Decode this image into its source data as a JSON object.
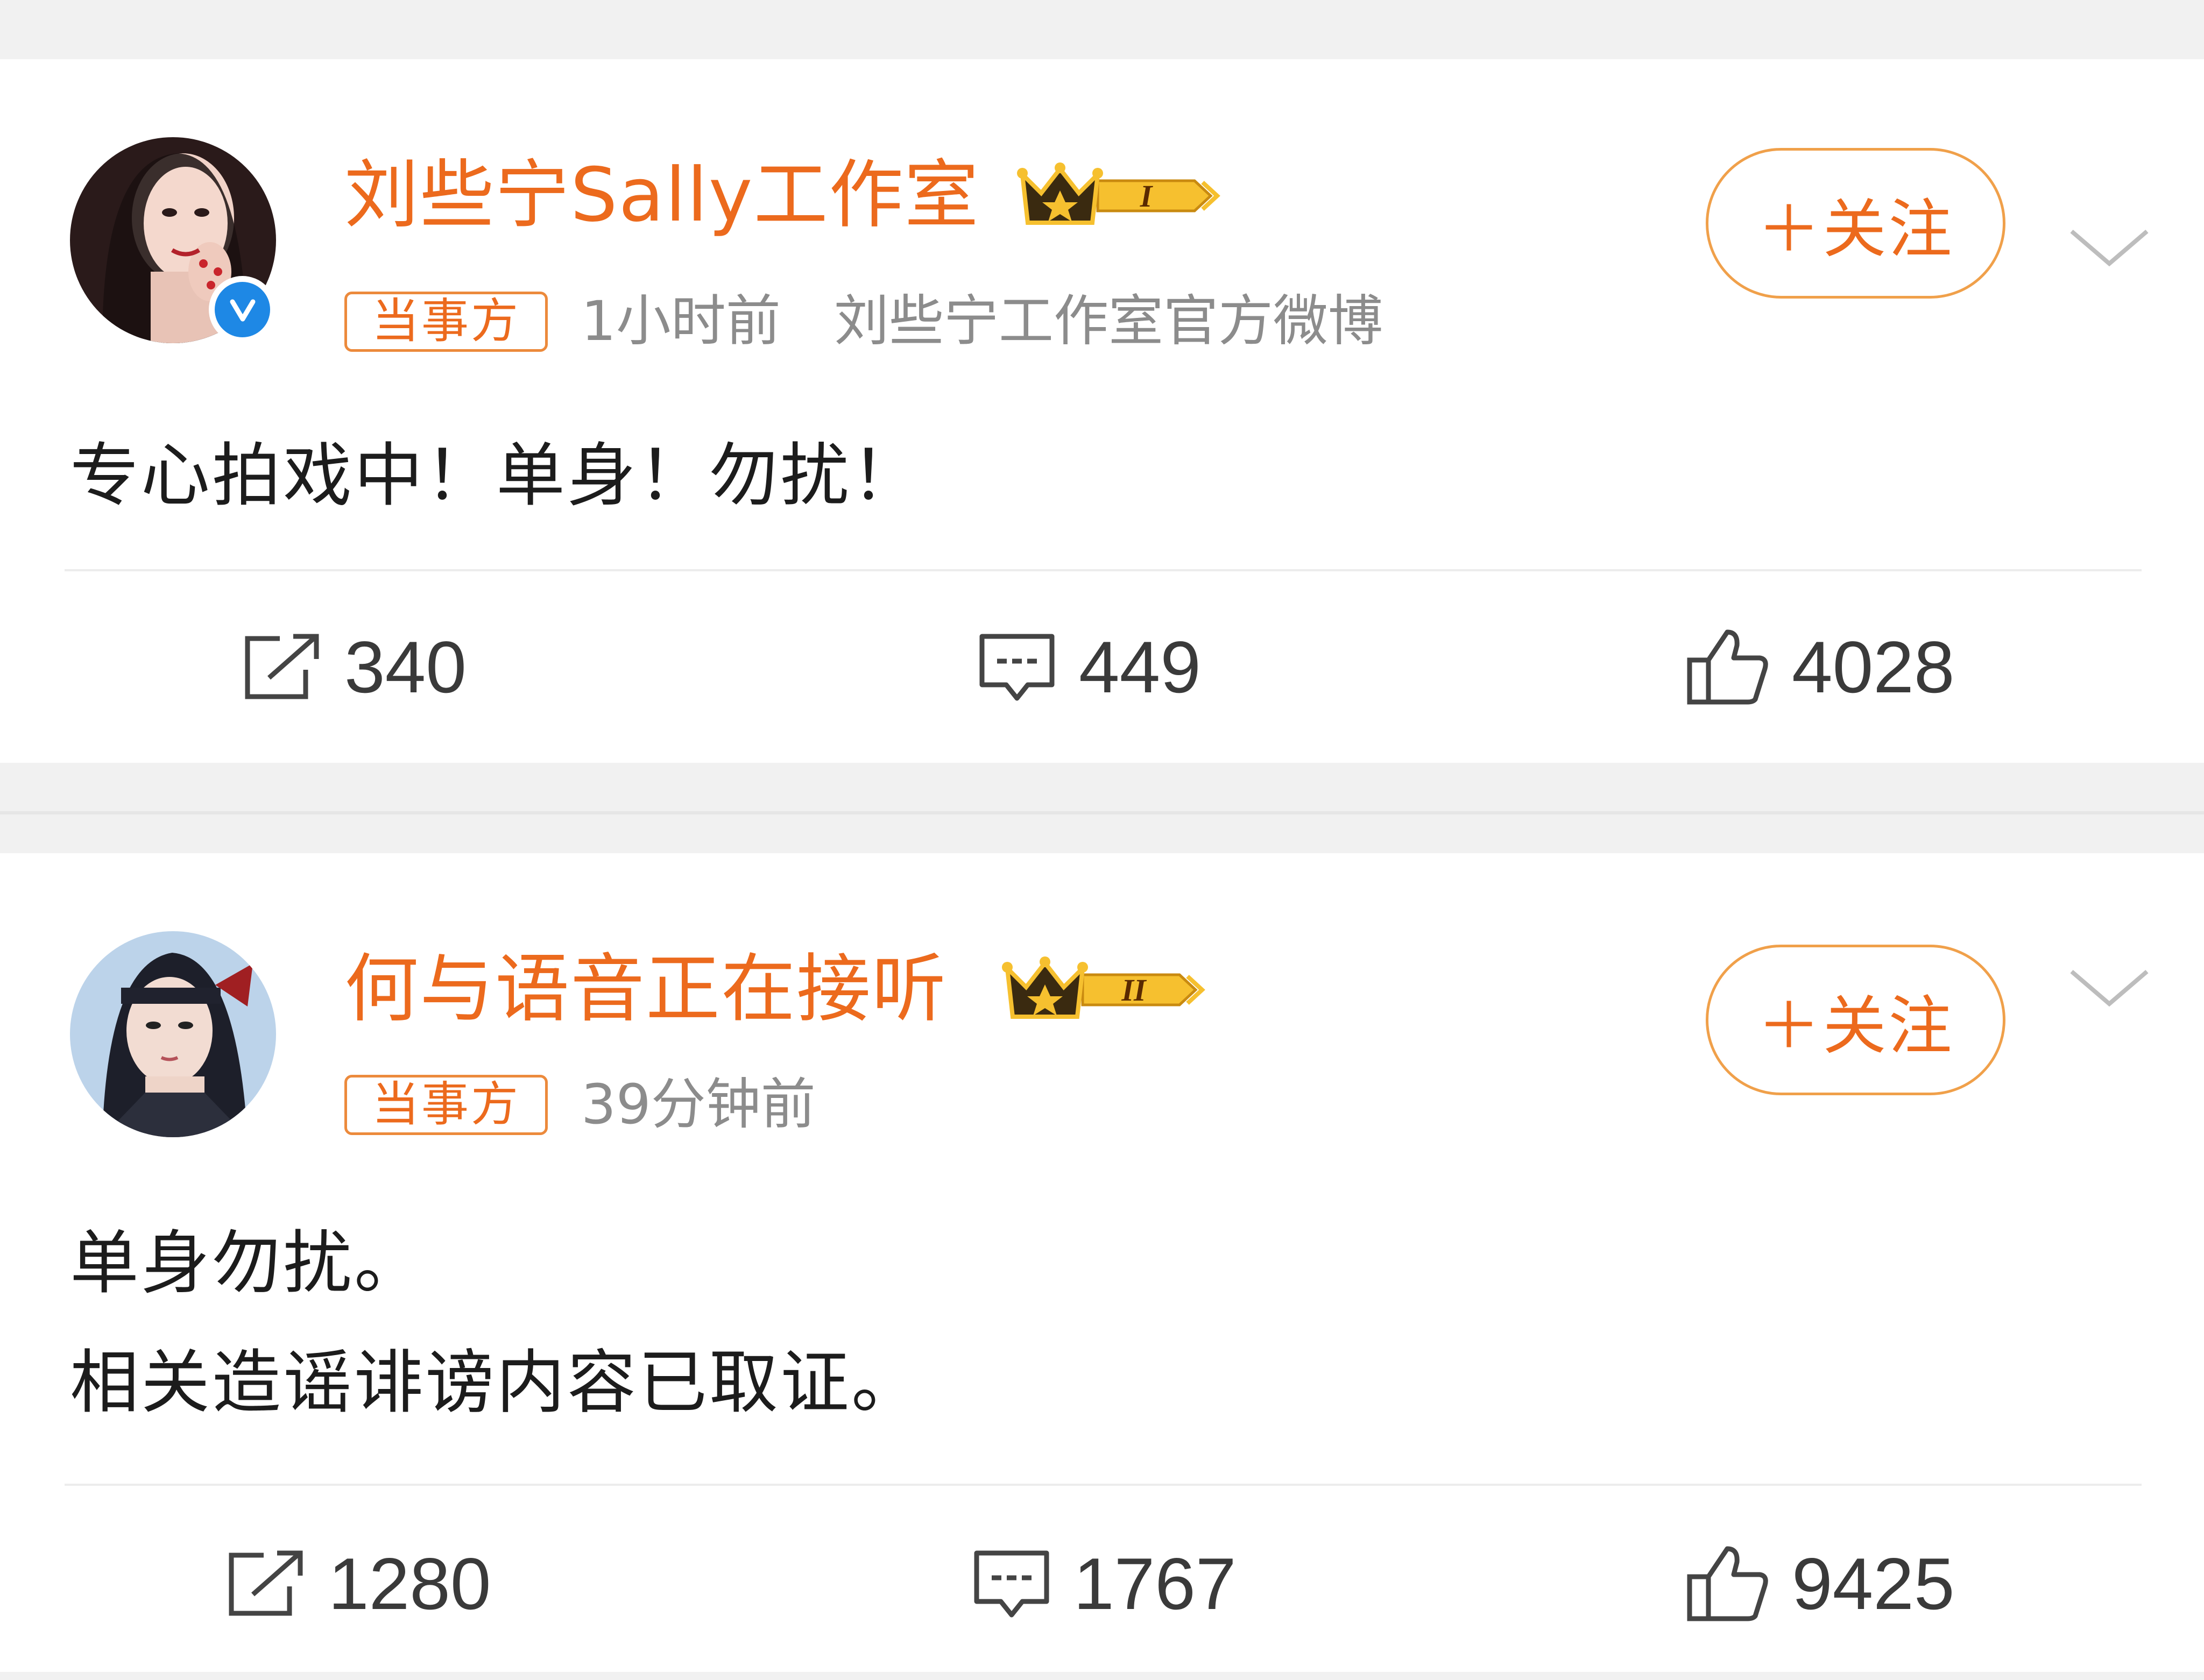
{
  "posts": [
    {
      "author": "刘些宁Sally工作室",
      "level_badge": "I",
      "tag": "当事方",
      "time": "1小时前",
      "source": "刘些宁工作室官方微博",
      "follow_label": "＋关注",
      "content_lines": [
        "专心拍戏中！单身！勿扰！"
      ],
      "reposts": "340",
      "comments": "449",
      "likes": "4028"
    },
    {
      "author": "何与语音正在接听",
      "level_badge": "II",
      "tag": "当事方",
      "time": "39分钟前",
      "follow_label": "＋关注",
      "content_lines": [
        "单身勿扰。",
        "相关造谣诽谤内容已取证。"
      ],
      "reposts": "1280",
      "comments": "1767",
      "likes": "9425"
    }
  ],
  "colors": {
    "accent": "#ec6a1d",
    "meta_text": "#8c8c8c",
    "verified_badge": "#1e88e5",
    "background_band": "#f1f1f1"
  },
  "icons": [
    "crown-icon",
    "verified-icon",
    "chevron-down-icon",
    "repost-icon",
    "comment-icon",
    "like-icon"
  ]
}
